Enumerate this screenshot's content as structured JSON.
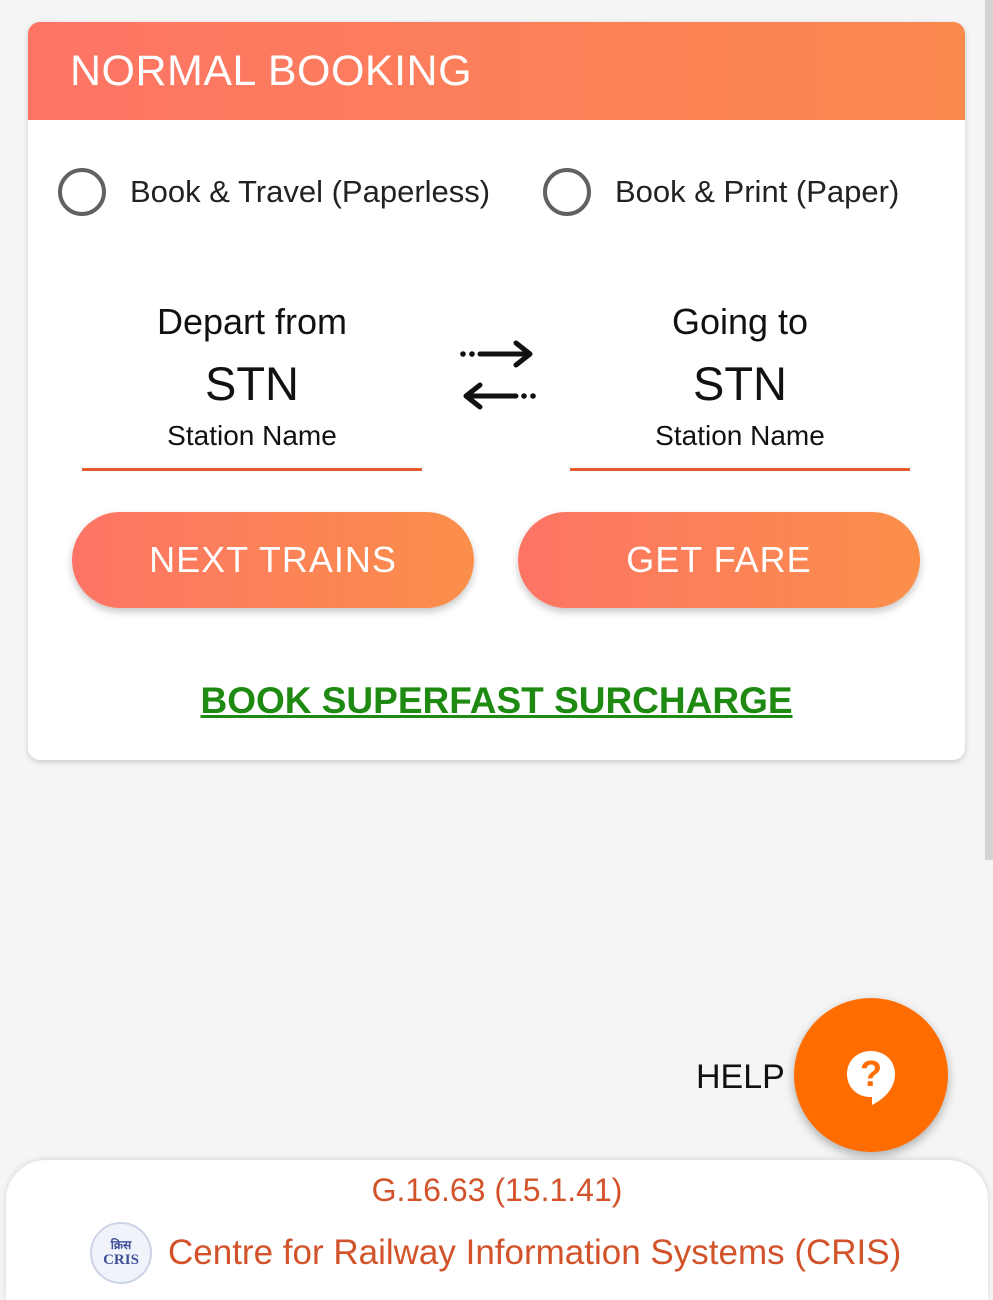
{
  "card": {
    "title": "NORMAL BOOKING",
    "radio_options": [
      {
        "label": "Book & Travel (Paperless)",
        "selected": false
      },
      {
        "label": "Book & Print (Paper)",
        "selected": false
      }
    ],
    "from": {
      "label": "Depart from",
      "code": "STN",
      "name": "Station Name"
    },
    "to": {
      "label": "Going to",
      "code": "STN",
      "name": "Station Name"
    },
    "swap_icon": "swap-arrows-icon",
    "next_trains_label": "NEXT TRAINS",
    "get_fare_label": "GET FARE",
    "superfast_link": "BOOK SUPERFAST SURCHARGE"
  },
  "help": {
    "label": "HELP",
    "icon": "question-bubble-icon"
  },
  "footer": {
    "version": "G.16.63 (15.1.41)",
    "logo": {
      "top": "क्रिस",
      "text": "CRIS"
    },
    "org_name": "Centre for Railway Information Systems (CRIS)"
  },
  "colors": {
    "header_gradient_start": "#fd7465",
    "header_gradient_end": "#fb8a4e",
    "link_green": "#1e8a12",
    "fab_orange": "#ff6d00",
    "footer_text": "#d2532a"
  }
}
